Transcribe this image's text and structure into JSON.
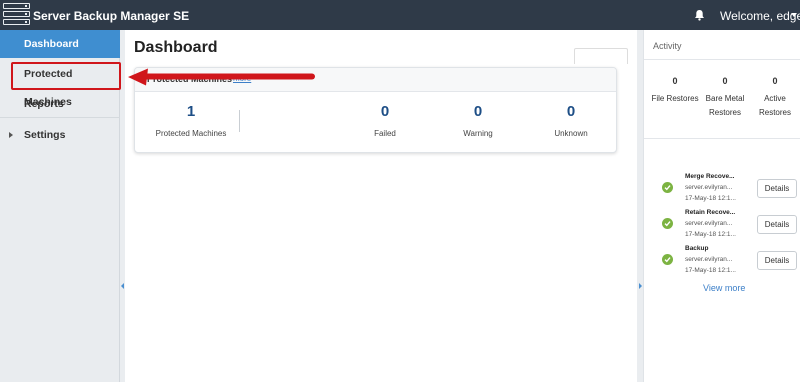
{
  "app": {
    "title": "Server Backup Manager SE",
    "welcome": "Welcome, edge"
  },
  "sidebar": {
    "items": [
      {
        "label": "Dashboard",
        "active": true
      },
      {
        "label": "Protected Machines"
      },
      {
        "label": "Reports"
      },
      {
        "label": "Settings"
      }
    ]
  },
  "main": {
    "title": "Dashboard",
    "card": {
      "title": "Protected Machines",
      "more_link": "more",
      "stats": [
        {
          "value": "1",
          "label": "Protected Machines"
        },
        {
          "value": "0",
          "label": "Failed"
        },
        {
          "value": "0",
          "label": "Warning"
        },
        {
          "value": "0",
          "label": "Unknown"
        }
      ]
    }
  },
  "activity": {
    "title": "Activity",
    "stats": [
      {
        "value": "0",
        "label_line1": "File Restores",
        "label_line2": ""
      },
      {
        "value": "0",
        "label_line1": "Bare Metal",
        "label_line2": "Restores"
      },
      {
        "value": "0",
        "label_line1": "Active",
        "label_line2": "Restores"
      }
    ],
    "jobs": [
      {
        "name": "Merge Recove...",
        "server": "server.evilyran...",
        "time": "17-May-18 12:1...",
        "status": "success",
        "details_label": "Details"
      },
      {
        "name": "Retain Recove...",
        "server": "server.evilyran...",
        "time": "17-May-18 12:1...",
        "status": "success",
        "details_label": "Details"
      },
      {
        "name": "Backup",
        "server": "server.evilyran...",
        "time": "17-May-18 12:1...",
        "status": "success",
        "details_label": "Details"
      }
    ],
    "view_more": "View more"
  },
  "colors": {
    "topbar": "#2f3a48",
    "active_nav": "#3f8ed0",
    "stat_number": "#1d4e86",
    "success": "#7cb342",
    "annotation_red": "#d0161b",
    "link": "#3c7fc8"
  }
}
